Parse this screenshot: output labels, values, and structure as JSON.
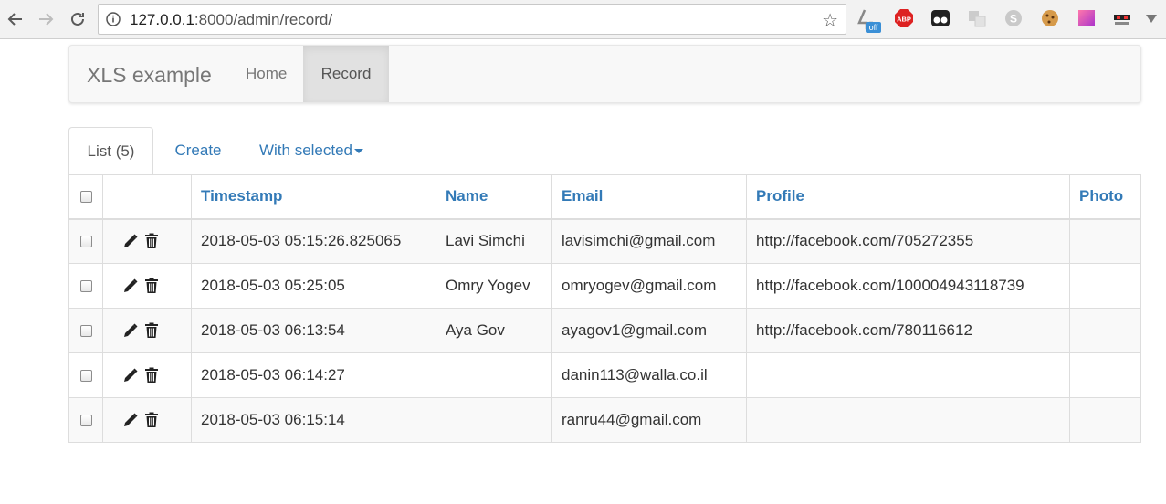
{
  "browser": {
    "url_host": "127.0.0.1",
    "url_rest": ":8000/admin/record/",
    "ext_badge": "off",
    "abp_label": "ABP"
  },
  "navbar": {
    "brand": "XLS example",
    "home": "Home",
    "record": "Record"
  },
  "tabs": {
    "list": "List (5)",
    "create": "Create",
    "with_selected": "With selected"
  },
  "table": {
    "headers": {
      "timestamp": "Timestamp",
      "name": "Name",
      "email": "Email",
      "profile": "Profile",
      "photo": "Photo"
    },
    "rows": [
      {
        "timestamp": "2018-05-03 05:15:26.825065",
        "name": "Lavi Simchi",
        "email": "lavisimchi@gmail.com",
        "profile": "http://facebook.com/705272355",
        "photo": ""
      },
      {
        "timestamp": "2018-05-03 05:25:05",
        "name": "Omry Yogev",
        "email": "omryogev@gmail.com",
        "profile": "http://facebook.com/100004943118739",
        "photo": ""
      },
      {
        "timestamp": "2018-05-03 06:13:54",
        "name": "Aya Gov",
        "email": "ayagov1@gmail.com",
        "profile": "http://facebook.com/780116612",
        "photo": ""
      },
      {
        "timestamp": "2018-05-03 06:14:27",
        "name": "",
        "email": "danin113@walla.co.il",
        "profile": "",
        "photo": ""
      },
      {
        "timestamp": "2018-05-03 06:15:14",
        "name": "",
        "email": "ranru44@gmail.com",
        "profile": "",
        "photo": ""
      }
    ]
  },
  "colors": {
    "link": "#337ab7",
    "navbar_bg": "#f8f8f8",
    "active_nav": "#e1e1e1",
    "stripe": "#f9f9f9"
  }
}
